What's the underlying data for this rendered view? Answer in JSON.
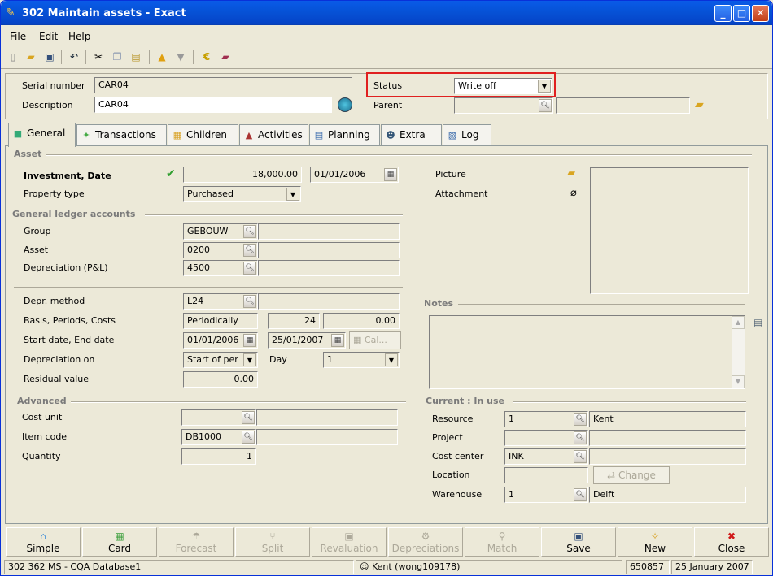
{
  "window": {
    "title": "302 Maintain assets - Exact",
    "min_glyph": "_",
    "max_glyph": "□",
    "close_glyph": "✕"
  },
  "menu": [
    "File",
    "Edit",
    "Help"
  ],
  "header": {
    "serial_label": "Serial number",
    "serial_value": "CAR04",
    "description_label": "Description",
    "description_value": "CAR04",
    "status_label": "Status",
    "status_value": "Write off",
    "parent_label": "Parent",
    "parent_value": ""
  },
  "tabs": [
    "General",
    "Transactions",
    "Children",
    "Activities",
    "Planning",
    "Extra",
    "Log"
  ],
  "asset": {
    "section": "Asset",
    "investment_label": "Investment, Date",
    "investment_value": "18,000.00",
    "investment_date": "01/01/2006",
    "property_type_label": "Property type",
    "property_type_value": "Purchased"
  },
  "gl": {
    "section": "General ledger accounts",
    "group_label": "Group",
    "group_value": "GEBOUW",
    "asset_label": "Asset",
    "asset_value": "0200",
    "depr_label": "Depreciation (P&L)",
    "depr_value": "4500"
  },
  "depr": {
    "method_label": "Depr. method",
    "method_value": "L24",
    "basis_label": "Basis, Periods, Costs",
    "basis_value": "Periodically",
    "periods_value": "24",
    "costs_value": "0.00",
    "dates_label": "Start date, End date",
    "start_value": "01/01/2006",
    "end_value": "25/01/2007",
    "calc_label": "Cal...",
    "on_label": "Depreciation on",
    "on_value": "Start of per",
    "day_label": "Day",
    "day_value": "1",
    "residual_label": "Residual value",
    "residual_value": "0.00"
  },
  "advanced": {
    "section": "Advanced",
    "cost_unit_label": "Cost unit",
    "cost_unit_value": "",
    "item_code_label": "Item code",
    "item_code_value": "DB1000",
    "quantity_label": "Quantity",
    "quantity_value": "1"
  },
  "right": {
    "picture_label": "Picture",
    "attachment_label": "Attachment",
    "notes_section": "Notes",
    "current_section": "Current : In use",
    "resource_label": "Resource",
    "resource_value": "1",
    "resource_name": "Kent",
    "project_label": "Project",
    "project_value": "",
    "cost_center_label": "Cost center",
    "cost_center_value": "INK",
    "location_label": "Location",
    "location_value": "",
    "change_label": "Change",
    "warehouse_label": "Warehouse",
    "warehouse_value": "1",
    "warehouse_name": "Delft"
  },
  "buttons": [
    {
      "label": "Simple",
      "enabled": true,
      "icon": "home-icon"
    },
    {
      "label": "Card",
      "enabled": true,
      "icon": "card-icon"
    },
    {
      "label": "Forecast",
      "enabled": false,
      "icon": "forecast-icon"
    },
    {
      "label": "Split",
      "enabled": false,
      "icon": "split-icon"
    },
    {
      "label": "Revaluation",
      "enabled": false,
      "icon": "revaluation-icon"
    },
    {
      "label": "Depreciations",
      "enabled": false,
      "icon": "gear-icon"
    },
    {
      "label": "Match",
      "enabled": false,
      "icon": "match-icon"
    },
    {
      "label": "Save",
      "enabled": true,
      "icon": "save-icon"
    },
    {
      "label": "New",
      "enabled": true,
      "icon": "new-icon"
    },
    {
      "label": "Close",
      "enabled": true,
      "icon": "close-icon"
    }
  ],
  "status": {
    "database": "302 362 MS - CQA Database1",
    "user": "Kent (wong109178)",
    "number": "650857",
    "date": "25 January 2007"
  },
  "colors": {
    "status_highlight": "#E02020",
    "check": "#2E9E2E"
  }
}
